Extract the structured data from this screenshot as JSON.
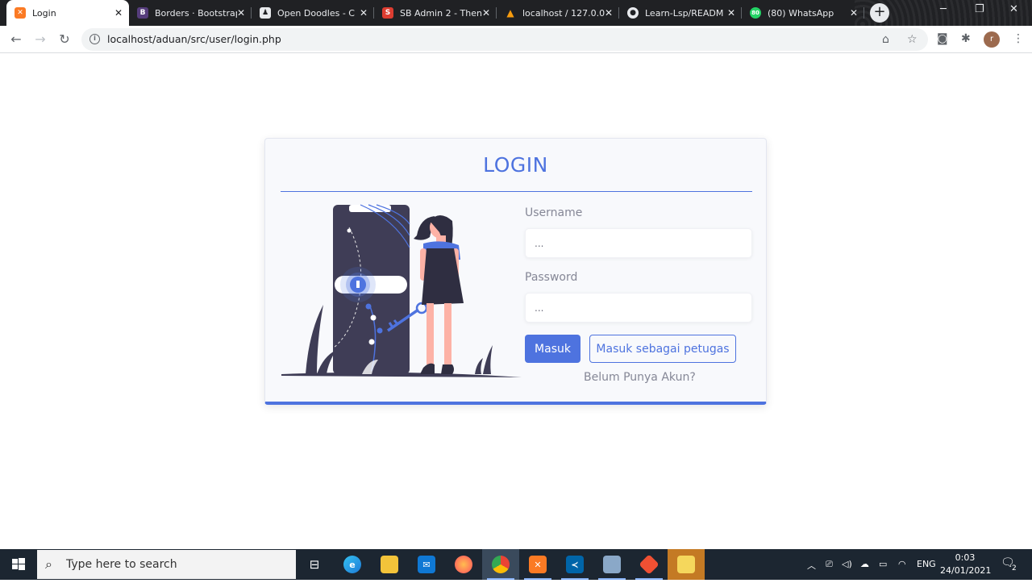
{
  "browser": {
    "tabs": [
      {
        "title": "Login",
        "favicon": "xampp-icon",
        "color": "#fb7a24"
      },
      {
        "title": "Borders · Bootstrap",
        "favicon": "bootstrap-icon",
        "color": "#563d7c"
      },
      {
        "title": "Open Doodles - C",
        "favicon": "doodle-icon",
        "color": "#202124"
      },
      {
        "title": "SB Admin 2 - Then",
        "favicon": "startbootstrap-icon",
        "color": "#dd3d31"
      },
      {
        "title": "localhost / 127.0.0",
        "favicon": "phpmyadmin-icon",
        "color": "#f89c0e"
      },
      {
        "title": "Learn-Lsp/READM",
        "favicon": "github-icon",
        "color": "#24292e"
      },
      {
        "title": "(80) WhatsApp",
        "favicon": "whatsapp-icon",
        "color": "#25d366"
      }
    ],
    "url": "localhost/aduan/src/user/login.php",
    "profile_initial": "r"
  },
  "login": {
    "title": "LOGIN",
    "username_label": "Username",
    "username_placeholder": "...",
    "password_label": "Password",
    "password_placeholder": "...",
    "submit_label": "Masuk",
    "officer_label": "Masuk sebagai petugas",
    "register_link": "Belum Punya Akun?",
    "accent": "#4e73df"
  },
  "taskbar": {
    "search_placeholder": "Type here to search",
    "language": "ENG",
    "time": "0:03",
    "date": "24/01/2021",
    "notifications": "2",
    "whatsapp_badge": "80"
  }
}
